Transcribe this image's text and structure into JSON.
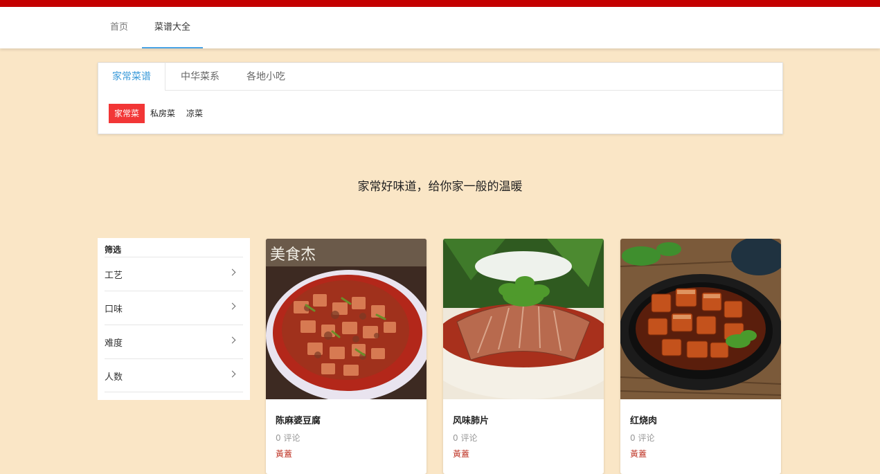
{
  "nav": {
    "home": "首页",
    "recipes": "菜谱大全"
  },
  "tabs": [
    {
      "label": "家常菜谱"
    },
    {
      "label": "中华菜系"
    },
    {
      "label": "各地小吃"
    }
  ],
  "subtags": [
    {
      "label": "家常菜"
    },
    {
      "label": "私房菜"
    },
    {
      "label": "凉菜"
    }
  ],
  "slogan": "家常好味道，给你家一般的温暖",
  "filter": {
    "title": "筛选",
    "items": [
      {
        "label": "工艺"
      },
      {
        "label": "口味"
      },
      {
        "label": "难度"
      },
      {
        "label": "人数"
      }
    ]
  },
  "cards": [
    {
      "title": "陈麻婆豆腐",
      "comments": "0 评论",
      "author": "黃蓋",
      "watermark": "美食杰"
    },
    {
      "title": "风味肺片",
      "comments": "0 评论",
      "author": "黃蓋"
    },
    {
      "title": "红烧肉",
      "comments": "0 评论",
      "author": "黃蓋"
    }
  ],
  "colors": {
    "background": "#fae6c6",
    "top_strip": "#c40000",
    "accent_blue": "#3a9ad9",
    "active_tag": "#f23636",
    "author_red": "#c0392b"
  }
}
